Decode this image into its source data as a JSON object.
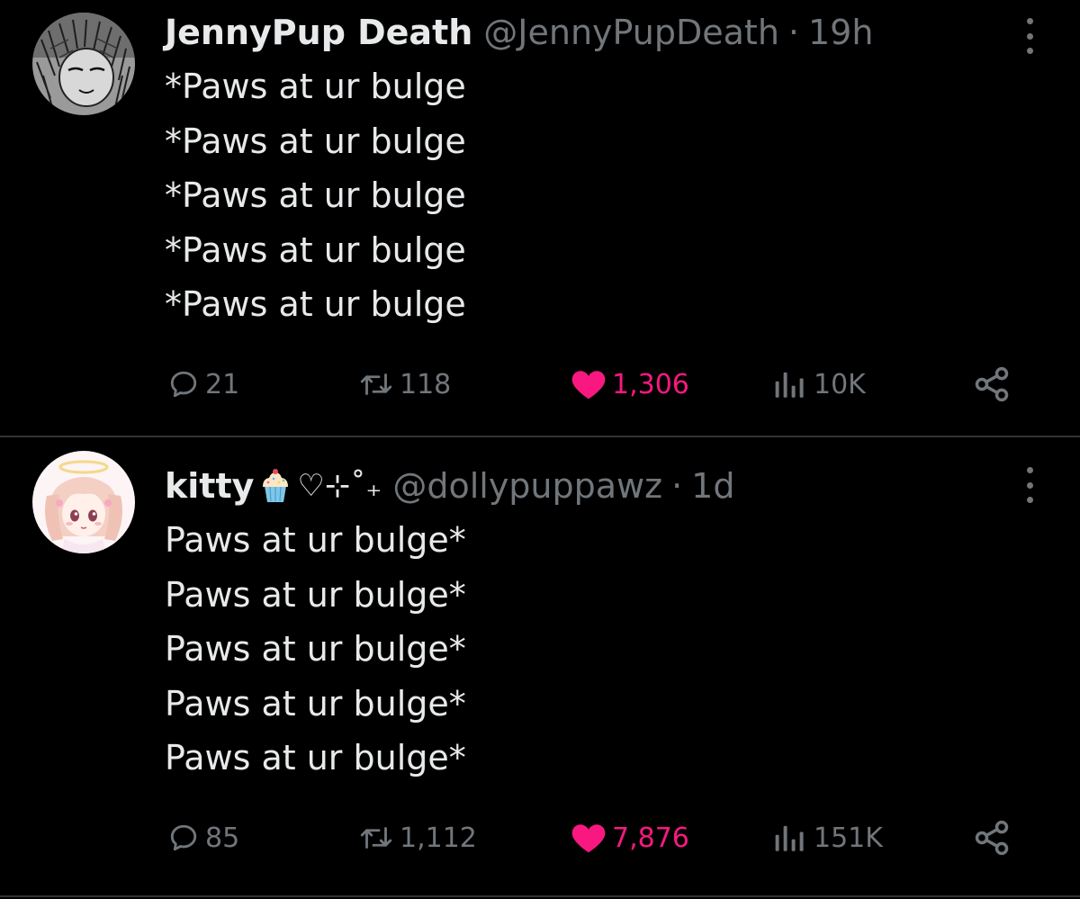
{
  "colors": {
    "background": "#000000",
    "primary_text": "#e7e9ea",
    "secondary_text": "#71767b",
    "liked_pink": "#f91880",
    "divider": "#2f3336"
  },
  "tweets": [
    {
      "display_name": "JennyPup Death",
      "handle": "@JennyPupDeath",
      "separator": "·",
      "time": "19h",
      "avatar_icon": "sketch-avatar",
      "lines": [
        "*Paws at ur bulge",
        "*Paws at ur bulge",
        "*Paws at ur bulge",
        "*Paws at ur bulge",
        "*Paws at ur bulge"
      ],
      "replies": "21",
      "reposts": "118",
      "likes": "1,306",
      "liked": true,
      "views": "10K"
    },
    {
      "display_name": "kitty",
      "name_emoji": "cupcake-emoji",
      "name_ornament": "♡⊹˚₊",
      "handle": "@dollypuppawz",
      "separator": "·",
      "time": "1d",
      "avatar_icon": "anime-girl-avatar",
      "lines": [
        "Paws at ur bulge*",
        "Paws at ur bulge*",
        "Paws at ur bulge*",
        "Paws at ur bulge*",
        "Paws at ur bulge*"
      ],
      "replies": "85",
      "reposts": "1,112",
      "likes": "7,876",
      "liked": true,
      "views": "151K"
    }
  ]
}
